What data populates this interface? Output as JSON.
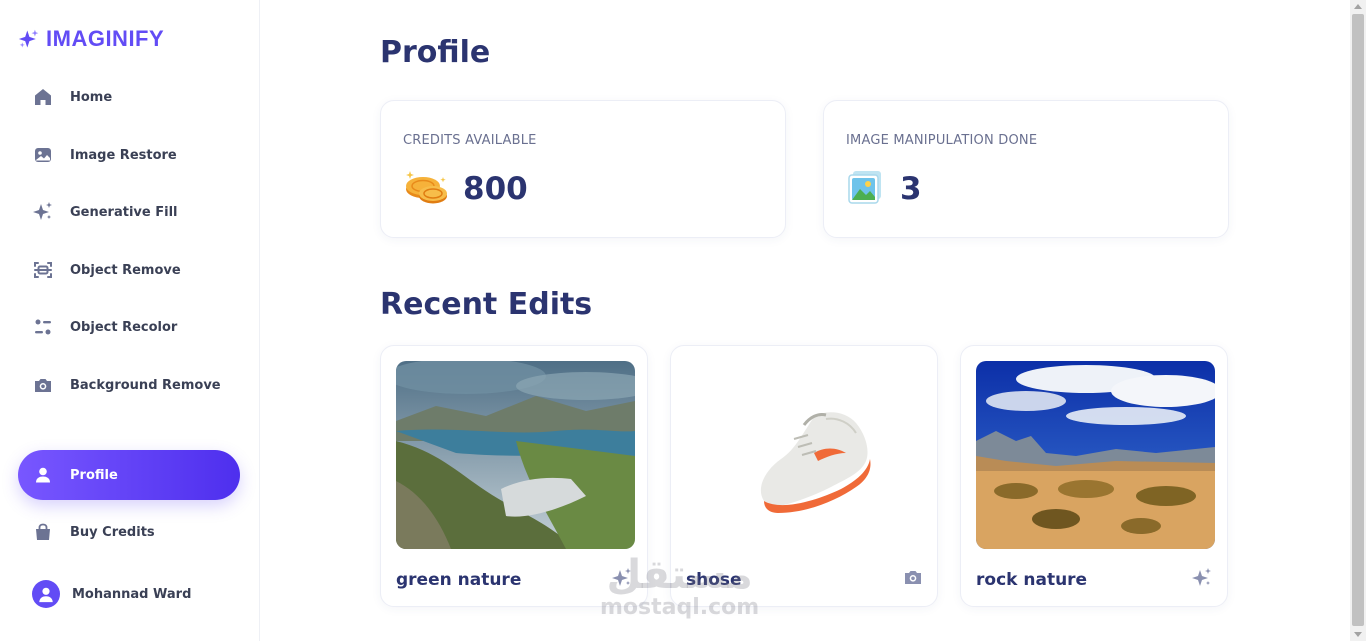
{
  "app": {
    "name": "IMAGINIFY",
    "logo_icon": "sparkle-icon",
    "accent": "#624cf5"
  },
  "sidebar": {
    "items": [
      {
        "label": "Home",
        "icon": "home-icon"
      },
      {
        "label": "Image Restore",
        "icon": "image-icon"
      },
      {
        "label": "Generative Fill",
        "icon": "sparkles-icon"
      },
      {
        "label": "Object Remove",
        "icon": "scan-icon"
      },
      {
        "label": "Object Recolor",
        "icon": "filter-icon"
      },
      {
        "label": "Background Remove",
        "icon": "camera-icon"
      },
      {
        "label": "Profile",
        "icon": "user-icon",
        "active": true
      },
      {
        "label": "Buy Credits",
        "icon": "bag-icon"
      }
    ],
    "user": {
      "name": "Mohannad Ward",
      "icon": "avatar-icon"
    }
  },
  "main": {
    "title": "Profile",
    "stats": [
      {
        "label": "CREDITS AVAILABLE",
        "value": "800",
        "icon": "coins-icon"
      },
      {
        "label": "IMAGE MANIPULATION DONE",
        "value": "3",
        "icon": "photo-icon"
      }
    ],
    "recent_title": "Recent Edits",
    "edits": [
      {
        "title": "green nature",
        "icon": "sparkles-icon"
      },
      {
        "title": "shose",
        "icon": "camera-icon"
      },
      {
        "title": "rock nature",
        "icon": "sparkles-icon"
      }
    ]
  },
  "watermark": {
    "arabic": "مستقل",
    "latin": "mostaql.com"
  }
}
